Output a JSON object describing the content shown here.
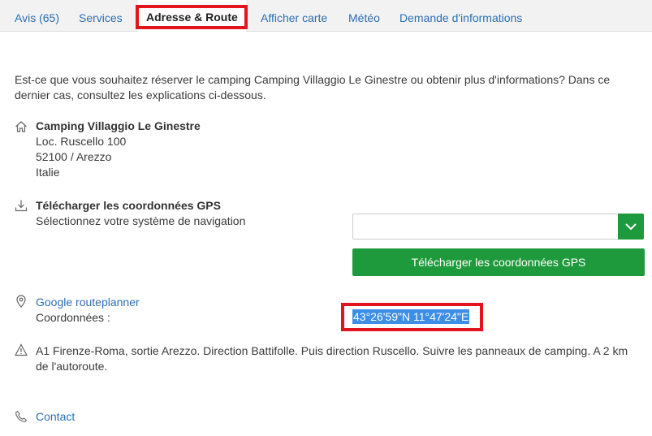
{
  "tabs": [
    {
      "label": "Avis (65)"
    },
    {
      "label": "Services"
    },
    {
      "label": "Adresse & Route"
    },
    {
      "label": "Afficher carte"
    },
    {
      "label": "Météo"
    },
    {
      "label": "Demande d'informations"
    }
  ],
  "intro": "Est-ce que vous souhaitez réserver le camping Camping Villaggio Le Ginestre ou obtenir plus d'informations? Dans ce dernier cas, consultez les explications ci-dessous.",
  "address": {
    "name": "Camping Villaggio Le Ginestre",
    "street": "Loc. Ruscello 100",
    "city": "52100 / Arezzo",
    "country": "Italie"
  },
  "gps": {
    "title": "Télécharger les coordonnées GPS",
    "subtitle": "Sélectionnez votre système de navigation",
    "select_value": "",
    "button_label": "Télécharger les coordonnées GPS"
  },
  "route": {
    "link": "Google routeplanner",
    "coords_label": "Coordonnées :",
    "coords_value": "43°26'59\"N 11°47'24\"E"
  },
  "directions": "A1 Firenze-Roma, sortie Arezzo. Direction Battifolle. Puis direction Ruscello. Suivre les panneaux de camping. A 2 km de l'autoroute.",
  "contact": "Contact",
  "colors": {
    "accent_green": "#1e9a3c",
    "link_blue": "#2b6fb3",
    "highlight_red": "#e3141e",
    "selection_blue": "#3d8ee6"
  }
}
